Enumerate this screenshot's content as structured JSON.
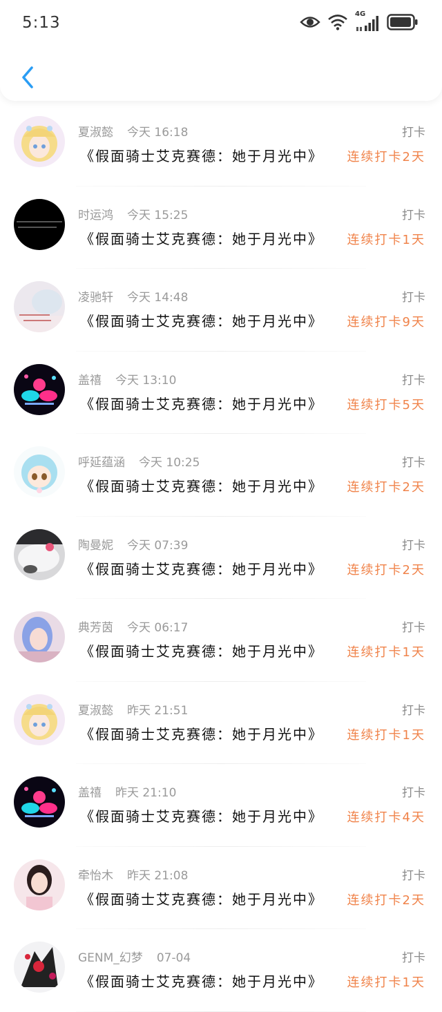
{
  "status_bar": {
    "time": "5:13",
    "network": "4G"
  },
  "header": {
    "back_icon": "chevron-left-icon",
    "accent_color": "#2a9df4"
  },
  "colors": {
    "streak": "#f0834a",
    "meta": "#9a9a9a"
  },
  "checkins": [
    {
      "name": "夏淑懿",
      "time": "今天 16:18",
      "tag": "打卡",
      "book": "《假面骑士艾克赛德：她于月光中》",
      "streak": "连续打卡2天",
      "avatar": "anime-girl-blonde"
    },
    {
      "name": "时运鸿",
      "time": "今天 15:25",
      "tag": "打卡",
      "book": "《假面骑士艾克赛德：她于月光中》",
      "streak": "连续打卡1天",
      "avatar": "black-text"
    },
    {
      "name": "凌驰轩",
      "time": "今天 14:48",
      "tag": "打卡",
      "book": "《假面骑士艾克赛德：她于月光中》",
      "streak": "连续打卡9天",
      "avatar": "soft-photo"
    },
    {
      "name": "盖禧",
      "time": "今天 13:10",
      "tag": "打卡",
      "book": "《假面骑士艾克赛德：她于月光中》",
      "streak": "连续打卡5天",
      "avatar": "neon-art"
    },
    {
      "name": "呼延蕴涵",
      "time": "今天 10:25",
      "tag": "打卡",
      "book": "《假面骑士艾克赛德：她于月光中》",
      "streak": "连续打卡2天",
      "avatar": "chibi-blue-hair"
    },
    {
      "name": "陶曼妮",
      "time": "今天 07:39",
      "tag": "打卡",
      "book": "《假面骑士艾克赛德：她于月光中》",
      "streak": "连续打卡2天",
      "avatar": "kitty-car"
    },
    {
      "name": "典芳茵",
      "time": "今天 06:17",
      "tag": "打卡",
      "book": "《假面骑士艾克赛德：她于月光中》",
      "streak": "连续打卡1天",
      "avatar": "girl-blue-hair"
    },
    {
      "name": "夏淑懿",
      "time": "昨天 21:51",
      "tag": "打卡",
      "book": "《假面骑士艾克赛德：她于月光中》",
      "streak": "连续打卡1天",
      "avatar": "anime-girl-blonde"
    },
    {
      "name": "盖禧",
      "time": "昨天 21:10",
      "tag": "打卡",
      "book": "《假面骑士艾克赛德：她于月光中》",
      "streak": "连续打卡4天",
      "avatar": "neon-art"
    },
    {
      "name": "牵怡木",
      "time": "昨天 21:08",
      "tag": "打卡",
      "book": "《假面骑士艾克赛德：她于月光中》",
      "streak": "连续打卡2天",
      "avatar": "girl-photo"
    },
    {
      "name": "GENM_幻梦",
      "time": "07-04",
      "tag": "打卡",
      "book": "《假面骑士艾克赛德：她于月光中》",
      "streak": "连续打卡1天",
      "avatar": "rider-art"
    }
  ]
}
